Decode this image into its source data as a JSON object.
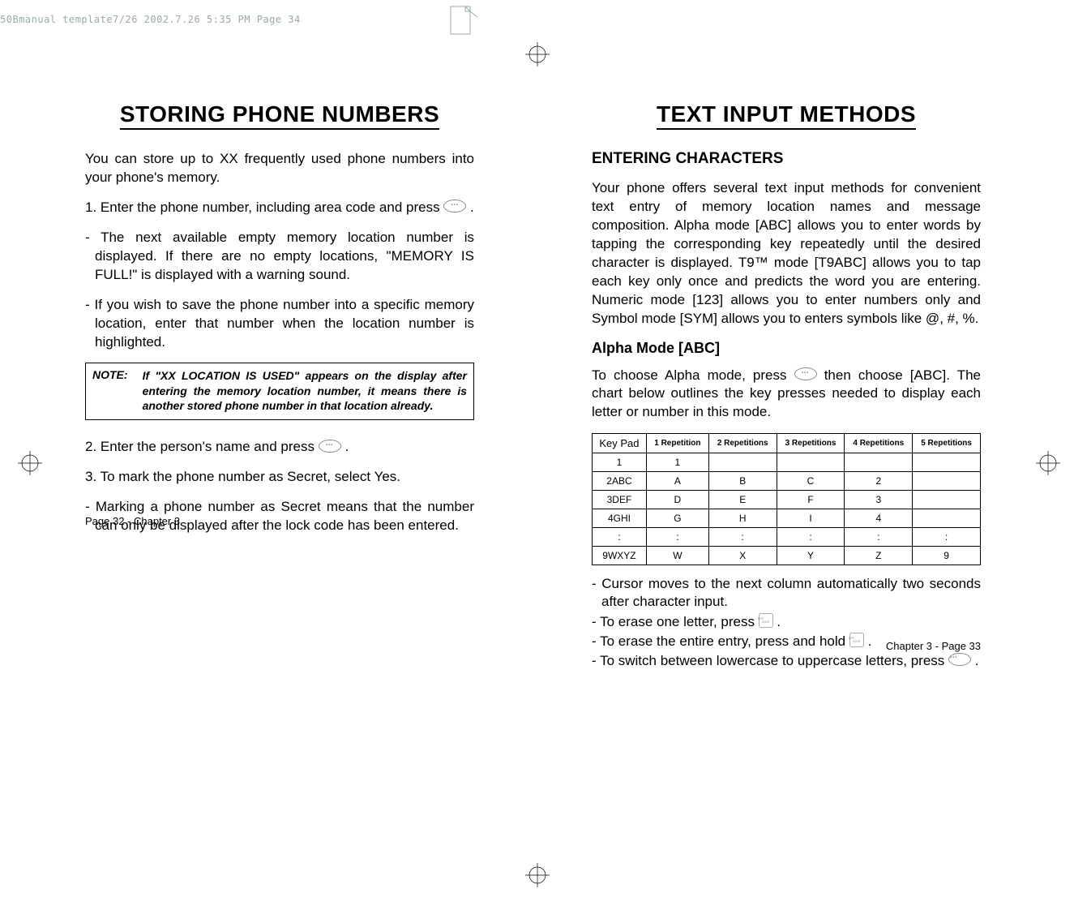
{
  "header_line": "50Bmanual template7/26  2002.7.26  5:35 PM  Page 34",
  "left": {
    "title": "STORING PHONE NUMBERS",
    "p_intro": "You can store up to XX frequently used phone numbers into your phone's memory.",
    "p_step1_a": "1. Enter the phone number, including area code and press ",
    "p_step1_b": " .",
    "p_dash1": "- The next available empty memory location number is displayed. If there are no empty locations, \"MEMORY IS FULL!\" is displayed with a warning sound.",
    "p_dash2": "- If you wish to save the phone number into a specific memory location, enter that number when the location number is highlighted.",
    "note_label": "NOTE:",
    "note_text": "If \"XX LOCATION IS USED\" appears on the display after entering the memory location number, it means there is another stored phone number in that location already.",
    "p_step2_a": "2. Enter the person's name and press  ",
    "p_step2_b": "  .",
    "p_step3": "3. To mark the phone number as Secret, select Yes.",
    "p_dash3": "- Marking a phone number as Secret means that the number can only be displayed after the lock code has been entered.",
    "footer": "Page 32 - Chapter 3"
  },
  "right": {
    "title": "TEXT INPUT METHODS",
    "sub1": "ENTERING CHARACTERS",
    "p_intro": "Your phone offers several text input methods for convenient text entry of memory location names and message composition. Alpha mode [ABC] allows you to enter words by tapping the corresponding key repeatedly until the desired character is displayed. T9™ mode [T9ABC] allows you to tap each key only once and predicts the word you are entering. Numeric mode [123] allows you to enter numbers only and Symbol mode [SYM] allows you to enters symbols like @, #, %.",
    "sub2": "Alpha Mode [ABC]",
    "p_alpha_a": "To choose Alpha mode, press ",
    "p_alpha_b": " then choose [ABC]. The chart below outlines the key presses needed to display each letter or number in this mode.",
    "table": {
      "headers": [
        "Key Pad",
        "1 Repetition",
        "2 Repetitions",
        "3 Repetitions",
        "4 Repetitions",
        "5 Repetitions"
      ],
      "rows": [
        [
          "1",
          "1",
          "",
          "",
          "",
          ""
        ],
        [
          "2ABC",
          "A",
          "B",
          "C",
          "2",
          ""
        ],
        [
          "3DEF",
          "D",
          "E",
          "F",
          "3",
          ""
        ],
        [
          "4GHI",
          "G",
          "H",
          "I",
          "4",
          ""
        ],
        [
          ":",
          ":",
          ":",
          ":",
          ":",
          ":"
        ],
        [
          "9WXYZ",
          "W",
          "X",
          "Y",
          "Z",
          "9"
        ]
      ]
    },
    "p_d1": "- Cursor moves to the next column automatically two seconds after character input.",
    "p_d2_a": "- To erase one letter, press  ",
    "p_d2_b": "   .",
    "p_d3_a": "- To erase the entire entry, press and hold  ",
    "p_d3_b": "  .",
    "p_d4_a": "- To switch between lowercase to uppercase letters, press   ",
    "p_d4_b": " .",
    "footer": "Chapter 3 - Page 33"
  }
}
